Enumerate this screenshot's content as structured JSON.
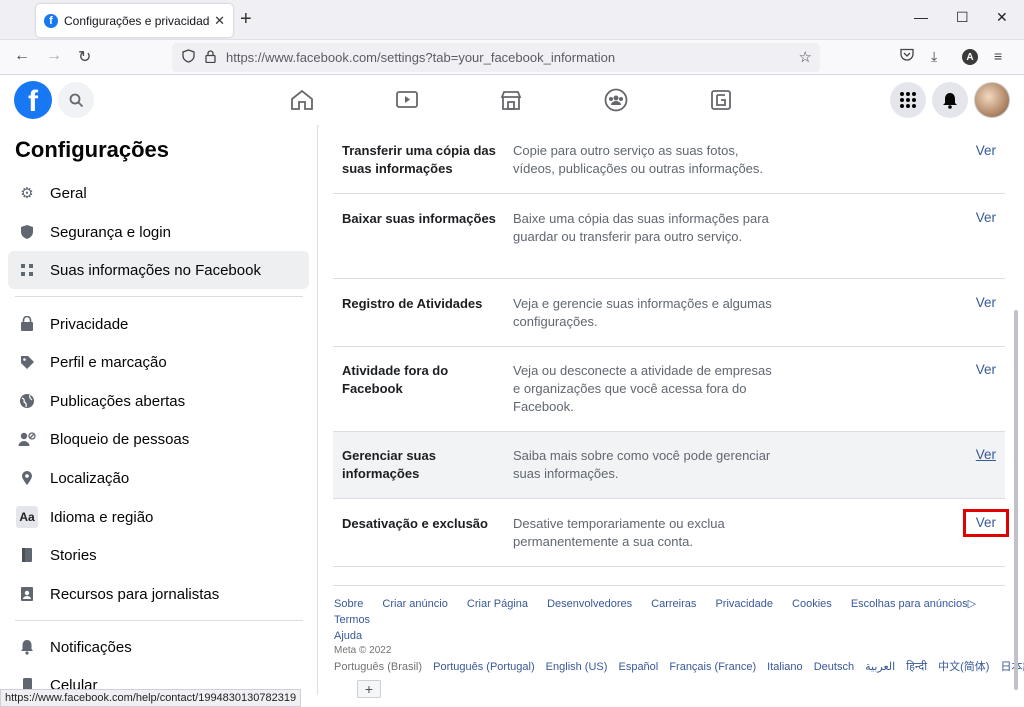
{
  "browser": {
    "tab_title": "Configurações e privacidade | Fa",
    "url": "https://www.facebook.com/settings?tab=your_facebook_information",
    "status_url": "https://www.facebook.com/help/contact/1994830130782319"
  },
  "sidebar": {
    "title": "Configurações",
    "items": [
      {
        "label": "Geral",
        "icon": "gear-icon"
      },
      {
        "label": "Segurança e login",
        "icon": "shield-icon"
      },
      {
        "label": "Suas informações no Facebook",
        "icon": "grid-icon"
      },
      {
        "label": "Privacidade",
        "icon": "lock-icon"
      },
      {
        "label": "Perfil e marcação",
        "icon": "tag-icon"
      },
      {
        "label": "Publicações abertas",
        "icon": "globe-icon"
      },
      {
        "label": "Bloqueio de pessoas",
        "icon": "block-user-icon"
      },
      {
        "label": "Localização",
        "icon": "location-pin-icon"
      },
      {
        "label": "Idioma e região",
        "icon": "language-icon"
      },
      {
        "label": "Stories",
        "icon": "book-icon"
      },
      {
        "label": "Recursos para jornalistas",
        "icon": "id-badge-icon"
      },
      {
        "label": "Notificações",
        "icon": "bell-icon"
      },
      {
        "label": "Celular",
        "icon": "phone-icon"
      }
    ]
  },
  "main": {
    "rows": [
      {
        "title": "Transferir uma cópia das suas informações",
        "desc": "Copie para outro serviço as suas fotos, vídeos, publicações ou outras informações.",
        "action": "Ver"
      },
      {
        "title": "Baixar suas informações",
        "desc": "Baixe uma cópia das suas informações para guardar ou transferir para outro serviço.",
        "action": "Ver"
      },
      {
        "title": "Registro de Atividades",
        "desc": "Veja e gerencie suas informações e algumas configurações.",
        "action": "Ver"
      },
      {
        "title": "Atividade fora do Facebook",
        "desc": "Veja ou desconecte a atividade de empresas e organizações que você acessa fora do Facebook.",
        "action": "Ver"
      },
      {
        "title": "Gerenciar suas informações",
        "desc": "Saiba mais sobre como você pode gerenciar suas informações.",
        "action": "Ver"
      },
      {
        "title": "Desativação e exclusão",
        "desc": "Desative temporariamente ou exclua permanentemente a sua conta.",
        "action": "Ver"
      }
    ]
  },
  "footer": {
    "links": [
      "Sobre",
      "Criar anúncio",
      "Criar Página",
      "Desenvolvedores",
      "Carreiras",
      "Privacidade",
      "Cookies",
      "Escolhas para anúncios",
      "Termos",
      "Ajuda"
    ],
    "copyright": "Meta © 2022",
    "current_language": "Português (Brasil)",
    "languages": [
      "Português (Portugal)",
      "English (US)",
      "Español",
      "Français (France)",
      "Italiano",
      "Deutsch",
      "العربية",
      "हिन्दी",
      "中文(简体)",
      "日本語"
    ],
    "plus": "+"
  },
  "colors": {
    "brand": "#1877f2",
    "link": "#385898",
    "highlight_box": "#e00000"
  }
}
